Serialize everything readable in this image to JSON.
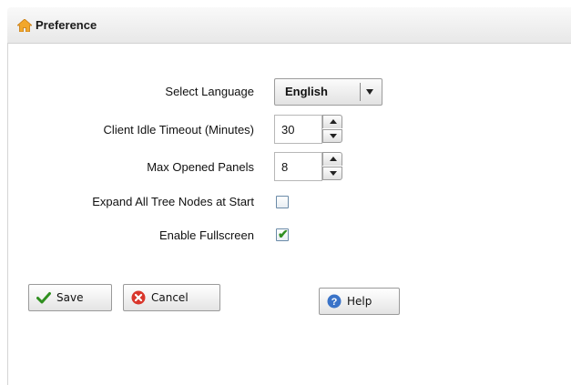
{
  "header": {
    "title": "Preference",
    "icon": "home-icon"
  },
  "form": {
    "language": {
      "label": "Select Language",
      "value": "English"
    },
    "idle_timeout": {
      "label": "Client Idle Timeout (Minutes)",
      "value": "30"
    },
    "max_panels": {
      "label": "Max Opened Panels",
      "value": "8"
    },
    "expand_tree": {
      "label": "Expand All Tree Nodes at Start",
      "checked": false
    },
    "fullscreen": {
      "label": "Enable Fullscreen",
      "checked": true
    }
  },
  "buttons": {
    "save": {
      "label": "Save",
      "icon": "checkmark-icon"
    },
    "cancel": {
      "label": "Cancel",
      "icon": "cancel-icon"
    },
    "help": {
      "label": "Help",
      "icon": "help-icon"
    }
  },
  "colors": {
    "header_icon": "#f2a72b",
    "check": "#2f8f1f",
    "cancel": "#d9362b",
    "help": "#3a73c8"
  }
}
